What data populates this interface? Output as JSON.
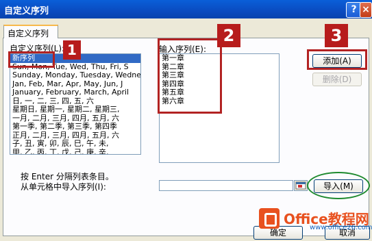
{
  "window": {
    "title": "自定义序列",
    "help_btn": "?",
    "close_btn": "×"
  },
  "tab": {
    "label": "自定义序列"
  },
  "custom_list": {
    "label": "自定义序列(L):",
    "items": [
      "新序列",
      "Sun, Mon, Tue, Wed, Thu, Fri, S",
      "Sunday, Monday, Tuesday, Wednes",
      "Jan, Feb, Mar, Apr, May, Jun, J",
      "January, February, March, April",
      "日, 一, 二, 三, 四, 五, 六",
      "星期日, 星期一, 星期二, 星期三,",
      "一月, 二月, 三月, 四月, 五月, 六",
      "第一季, 第二季, 第三季, 第四季",
      "正月, 二月, 三月, 四月, 五月, 六",
      "子, 丑, 寅, 卯, 辰, 巳, 午, 未,",
      "甲, 乙, 丙, 丁, 戊, 己, 庚, 辛,"
    ]
  },
  "entries": {
    "label": "输入序列(E):",
    "items": [
      "第一章",
      "第二章",
      "第三章",
      "第四章",
      "第五章",
      "第六章"
    ]
  },
  "buttons": {
    "add": "添加(A)",
    "delete": "删除(D)",
    "import": "导入(M)",
    "ok": "确定",
    "cancel": "取消"
  },
  "hint": "按 Enter 分隔列表条目。",
  "import_label": "从单元格中导入序列(I):",
  "import_value": "",
  "badges": [
    "1",
    "2",
    "3"
  ],
  "watermark": {
    "brand": "Office教程网",
    "url": "www.office26.com"
  },
  "colors": {
    "accent_red": "#b22222",
    "green_ellipse": "#1e8a2e",
    "selection": "#316ac5"
  }
}
